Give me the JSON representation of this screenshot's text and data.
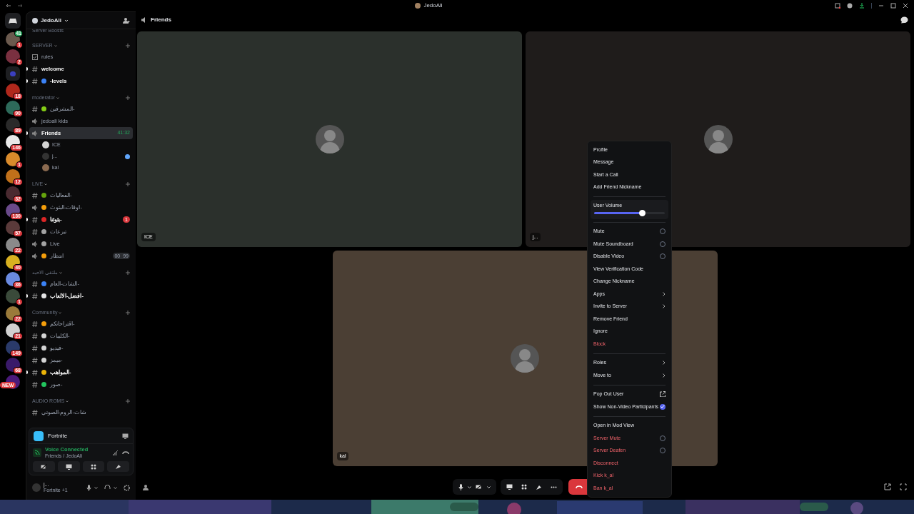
{
  "window": {
    "title": "JedoAli"
  },
  "servers": [
    {
      "color": "#6b5a4e",
      "badge": "1",
      "top_badge": "41"
    },
    {
      "color": "#7a3040",
      "badge": "2"
    },
    {
      "color": "#3b3fbf",
      "kind": "folder"
    },
    {
      "color": "#b0281c",
      "badge": "18"
    },
    {
      "color": "#2d6a5a",
      "badge": "90"
    },
    {
      "color": "#2a2a2a",
      "badge": "89"
    },
    {
      "color": "#e8e8e8",
      "badge": "146"
    },
    {
      "color": "#d98a2b",
      "badge": "1"
    },
    {
      "color": "#c0701a",
      "badge": "12"
    },
    {
      "color": "#4a2a30",
      "badge": "32"
    },
    {
      "color": "#6a4a8a",
      "badge": "130"
    },
    {
      "color": "#5a3a3a",
      "badge": "57"
    },
    {
      "color": "#8a8a8a",
      "badge": "22"
    },
    {
      "color": "#d8b020",
      "badge": "40"
    },
    {
      "color": "#6a8ae0",
      "badge": "36"
    },
    {
      "color": "#3a4a3a",
      "badge": "1"
    },
    {
      "color": "#9a7a3a",
      "badge": "22"
    },
    {
      "color": "#d0d0d0",
      "badge": "21"
    },
    {
      "color": "#2a3a6a",
      "badge": "149"
    },
    {
      "color": "#3a1a6a",
      "badge": "68"
    },
    {
      "color": "#4a1a7a",
      "badge": "NEW"
    }
  ],
  "sidebar": {
    "server_name": "JedoAli",
    "boosts": "Server Boosts",
    "categories": [
      {
        "name": "SERVER",
        "channels": [
          {
            "kind": "rules",
            "name": "rules",
            "unread": false
          },
          {
            "kind": "text",
            "name": "welcome",
            "unread": true
          },
          {
            "kind": "text",
            "name": "-levels",
            "unread": true,
            "color": "#3b82f6"
          }
        ]
      },
      {
        "name": "moderator",
        "channels": [
          {
            "kind": "text",
            "name": "المشرفين-",
            "unread": false,
            "color": "#84cc16"
          },
          {
            "kind": "voice",
            "name": "jedoali kids",
            "unread": false
          },
          {
            "kind": "voice",
            "name": "Friends",
            "unread": true,
            "selected": true,
            "time": "41:32",
            "users": [
              {
                "name": "ICE",
                "color": "#d4d4d4"
              },
              {
                "name": "j...",
                "color": "#333333",
                "live": true
              },
              {
                "name": "kal",
                "color": "#8a6a50"
              }
            ]
          }
        ]
      },
      {
        "name": "LIVE",
        "channels": [
          {
            "kind": "text",
            "name": "الفعاليات-",
            "unread": false,
            "color": "#65a30d"
          },
          {
            "kind": "voice",
            "name": "اوقات-البثوث-",
            "unread": false,
            "color": "#f59e0b"
          },
          {
            "kind": "text",
            "name": "بثوثنا-",
            "unread": true,
            "color": "#dc2626",
            "badge": "1"
          },
          {
            "kind": "text",
            "name": "تبرعات",
            "unread": false,
            "color": "#a3a3a3"
          },
          {
            "kind": "voice",
            "name": "Live",
            "unread": false,
            "color": "#a3a3a3"
          },
          {
            "kind": "voice",
            "name": "انتظار",
            "unread": false,
            "color": "#f59e0b",
            "limit": [
              "00",
              "99"
            ]
          }
        ]
      },
      {
        "name": "ملتقى الاحبه",
        "channels": [
          {
            "kind": "text",
            "name": "الشات-العام-",
            "unread": false,
            "color": "#3b82f6"
          },
          {
            "kind": "text",
            "name": "افضل-الالعاب-",
            "unread": true,
            "color": "#e5e5e5"
          }
        ]
      },
      {
        "name": "Community",
        "channels": [
          {
            "kind": "text",
            "name": "اقتراحاتكم-",
            "unread": false,
            "color": "#f59e0b"
          },
          {
            "kind": "text",
            "name": "الكليبات-",
            "unread": false,
            "color": "#d4d4d4"
          },
          {
            "kind": "text",
            "name": "فيديو-",
            "unread": false,
            "color": "#d4d4d4"
          },
          {
            "kind": "text",
            "name": "ميمز-",
            "unread": false,
            "color": "#d4d4d4"
          },
          {
            "kind": "text",
            "name": "المواهب-",
            "unread": true,
            "color": "#eab308"
          },
          {
            "kind": "text",
            "name": "صور-",
            "unread": false,
            "color": "#22c55e"
          }
        ]
      },
      {
        "name": "AUDIO ROMS",
        "channels": [
          {
            "kind": "text",
            "name": "شات-الروم-الصوتي",
            "unread": false
          }
        ]
      }
    ]
  },
  "activity": {
    "name": "Fortnite"
  },
  "voice": {
    "status": "Voice Connected",
    "location": "Friends / JedoAli"
  },
  "user": {
    "name": "j...",
    "status": "Fortnite +1"
  },
  "header": {
    "channel": "Friends"
  },
  "tiles": [
    {
      "name": "ICE",
      "color": "#2b302c"
    },
    {
      "name": "j...",
      "color": "#1f1c1b"
    },
    {
      "name": "kal",
      "color": "#4b3f34"
    }
  ],
  "menu": [
    {
      "kind": "item",
      "label": "Profile"
    },
    {
      "kind": "item",
      "label": "Message"
    },
    {
      "kind": "item",
      "label": "Start a Call"
    },
    {
      "kind": "item",
      "label": "Add Friend Nickname"
    },
    {
      "kind": "divider"
    },
    {
      "kind": "slider",
      "label": "User Volume",
      "level": 0.68
    },
    {
      "kind": "divider"
    },
    {
      "kind": "check",
      "label": "Mute",
      "checked": false
    },
    {
      "kind": "check",
      "label": "Mute Soundboard",
      "checked": false
    },
    {
      "kind": "check",
      "label": "Disable Video",
      "checked": false
    },
    {
      "kind": "item",
      "label": "View Verification Code"
    },
    {
      "kind": "item",
      "label": "Change Nickname"
    },
    {
      "kind": "submenu",
      "label": "Apps"
    },
    {
      "kind": "submenu",
      "label": "Invite to Server"
    },
    {
      "kind": "item",
      "label": "Remove Friend"
    },
    {
      "kind": "item",
      "label": "Ignore"
    },
    {
      "kind": "danger",
      "label": "Block"
    },
    {
      "kind": "divider"
    },
    {
      "kind": "submenu",
      "label": "Roles"
    },
    {
      "kind": "submenu",
      "label": "Move to"
    },
    {
      "kind": "divider"
    },
    {
      "kind": "popout",
      "label": "Pop Out User"
    },
    {
      "kind": "check",
      "label": "Show Non-Video Participants",
      "checked": true
    },
    {
      "kind": "divider"
    },
    {
      "kind": "item",
      "label": "Open in Mod View"
    },
    {
      "kind": "dangercheck",
      "label": "Server Mute",
      "checked": false
    },
    {
      "kind": "dangercheck",
      "label": "Server Deafen",
      "checked": false
    },
    {
      "kind": "danger",
      "label": "Disconnect"
    },
    {
      "kind": "danger",
      "label": "Kick k_al"
    },
    {
      "kind": "danger",
      "label": "Ban k_al"
    }
  ]
}
